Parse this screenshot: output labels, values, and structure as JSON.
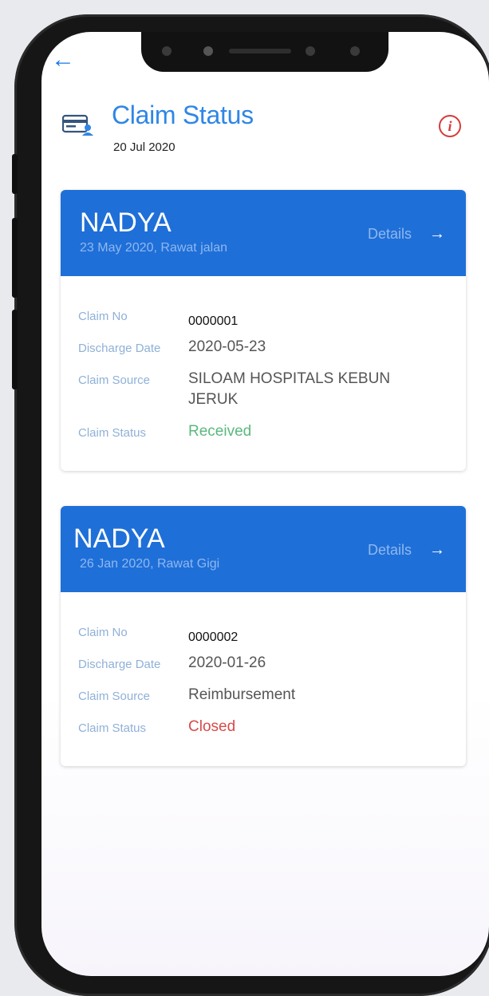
{
  "header": {
    "back_icon": "arrow-left-icon",
    "title": "Claim Status",
    "date": "20 Jul 2020",
    "info_icon": "info-icon",
    "info_glyph": "i"
  },
  "claims": [
    {
      "name": "NADYA",
      "subtitle": "23 May 2020, Rawat jalan",
      "details_label": "Details",
      "details_arrow": "→",
      "labels": {
        "claim_no": "Claim No",
        "discharge_date": "Discharge Date",
        "claim_source": "Claim Source",
        "claim_status": "Claim Status"
      },
      "claim_no": "0000001",
      "discharge_date": "2020-05-23",
      "claim_source": "SILOAM HOSPITALS KEBUN JERUK",
      "claim_status": "Received",
      "status_color": "#5cb87f"
    },
    {
      "name": "NADYA",
      "subtitle": "26 Jan 2020, Rawat Gigi",
      "details_label": "Details",
      "details_arrow": "→",
      "labels": {
        "claim_no": "Claim No",
        "discharge_date": "Discharge Date",
        "claim_source": "Claim Source",
        "claim_status": "Claim Status"
      },
      "claim_no": "0000002",
      "discharge_date": "2020-01-26",
      "claim_source": "Reimbursement",
      "claim_status": "Closed",
      "status_color": "#d84a4a"
    }
  ],
  "colors": {
    "accent": "#1f6fd8",
    "title": "#2f86e6",
    "info": "#d63a3a"
  }
}
